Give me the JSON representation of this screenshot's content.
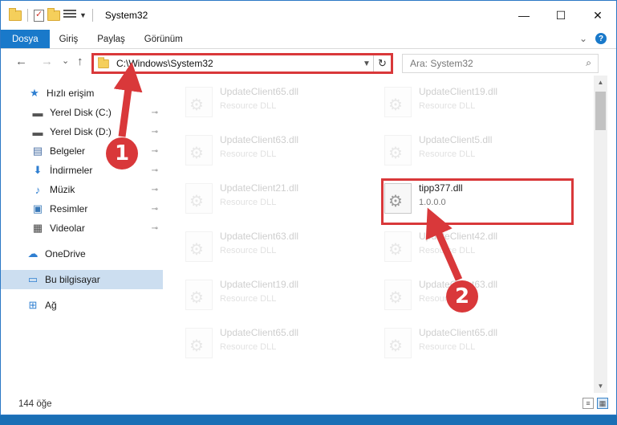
{
  "window": {
    "title": "System32",
    "controls": {
      "minimize": "—",
      "maximize": "☐",
      "close": "✕"
    }
  },
  "ribbon": {
    "tabs": [
      "Dosya",
      "Giriş",
      "Paylaş",
      "Görünüm"
    ],
    "help": "?"
  },
  "nav": {
    "back": "←",
    "forward": "→",
    "recent": "⌄",
    "up": "↑",
    "address": "C:\\Windows\\System32",
    "search_placeholder": "Ara: System32"
  },
  "sidebar": {
    "items": [
      {
        "label": "Hızlı erişim",
        "icon": "star-icon",
        "glyph": "★",
        "color": "#2f7fd1"
      },
      {
        "label": "Yerel Disk (C:)",
        "icon": "drive-icon",
        "glyph": "▬",
        "color": "#555555",
        "pinned": true
      },
      {
        "label": "Yerel Disk (D:)",
        "icon": "drive-icon",
        "glyph": "▬",
        "color": "#555555",
        "pinned": true
      },
      {
        "label": "Belgeler",
        "icon": "documents-icon",
        "glyph": "▤",
        "color": "#4a6fa5",
        "pinned": true
      },
      {
        "label": "İndirmeler",
        "icon": "download-icon",
        "glyph": "⬇",
        "color": "#2f7fd1",
        "pinned": true
      },
      {
        "label": "Müzik",
        "icon": "music-icon",
        "glyph": "♪",
        "color": "#2f7fd1",
        "pinned": true
      },
      {
        "label": "Resimler",
        "icon": "pictures-icon",
        "glyph": "▣",
        "color": "#3a79b8",
        "pinned": true
      },
      {
        "label": "Videolar",
        "icon": "video-icon",
        "glyph": "▦",
        "color": "#444444",
        "pinned": true
      },
      {
        "label": "OneDrive",
        "icon": "cloud-icon",
        "glyph": "☁",
        "color": "#2f7fd1"
      },
      {
        "label": "Bu bilgisayar",
        "icon": "computer-icon",
        "glyph": "▭",
        "color": "#2f7fd1",
        "selected": true
      },
      {
        "label": "Ağ",
        "icon": "network-icon",
        "glyph": "⊞",
        "color": "#2f7fd1"
      }
    ]
  },
  "files": [
    {
      "name": "UpdateClient65.dll",
      "desc": "Resource DLL",
      "faded": true
    },
    {
      "name": "UpdateClient19.dll",
      "desc": "Resource DLL",
      "faded": true
    },
    {
      "name": "UpdateClient63.dll",
      "desc": "Resource DLL",
      "faded": true
    },
    {
      "name": "UpdateClient5.dll",
      "desc": "Resource DLL",
      "faded": true
    },
    {
      "name": "UpdateClient21.dll",
      "desc": "Resource DLL",
      "faded": true
    },
    {
      "name": "tipp377.dll",
      "desc": "1.0.0.0",
      "faded": false
    },
    {
      "name": "UpdateClient63.dll",
      "desc": "Resource DLL",
      "faded": true
    },
    {
      "name": "UpdateClient42.dll",
      "desc": "Resource DLL",
      "faded": true
    },
    {
      "name": "UpdateClient19.dll",
      "desc": "Resource DLL",
      "faded": true
    },
    {
      "name": "UpdateClient63.dll",
      "desc": "Resource DLL",
      "faded": true
    },
    {
      "name": "UpdateClient65.dll",
      "desc": "Resource DLL",
      "faded": true
    },
    {
      "name": "UpdateClient65.dll",
      "desc": "Resource DLL",
      "faded": true
    }
  ],
  "status": {
    "count": "144 öğe"
  },
  "callouts": {
    "one": "1",
    "two": "2",
    "color": "#d9383a"
  }
}
